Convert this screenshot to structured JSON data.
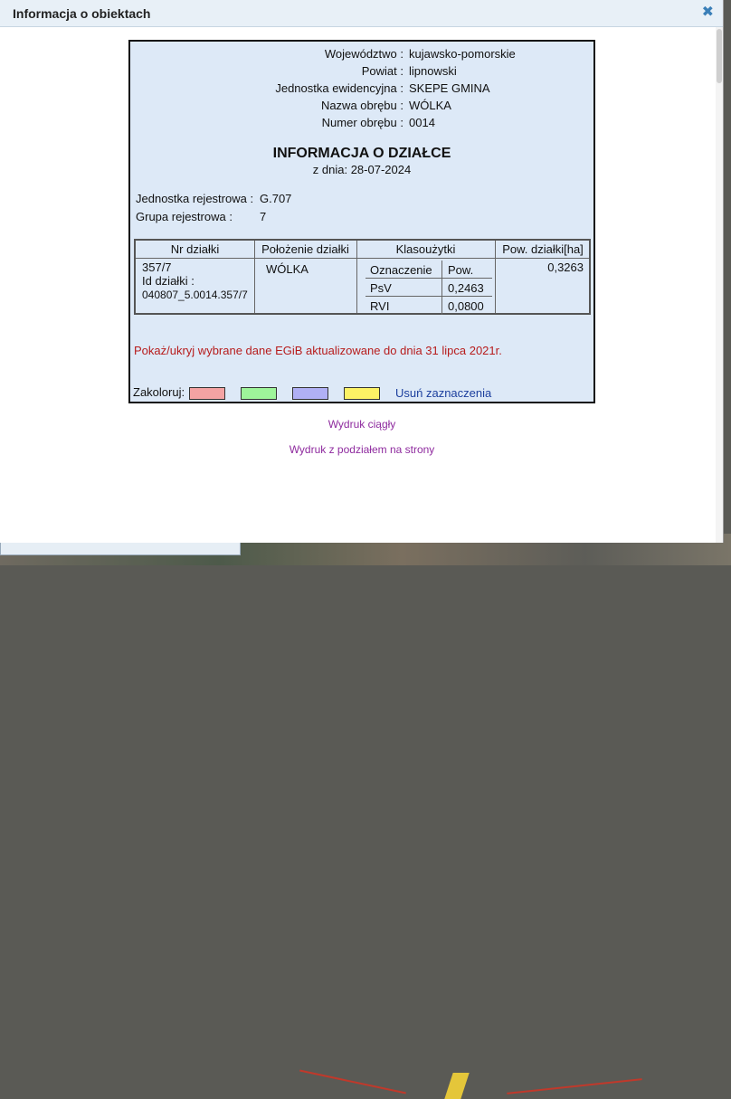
{
  "dialog": {
    "title": "Informacja o obiektach",
    "close_glyph": "✖"
  },
  "location": [
    {
      "label": "Województwo :",
      "value": "kujawsko-pomorskie"
    },
    {
      "label": "Powiat :",
      "value": "lipnowski"
    },
    {
      "label": "Jednostka ewidencyjna :",
      "value": "SKEPE GMINA"
    },
    {
      "label": "Nazwa obrębu :",
      "value": "WÓLKA"
    },
    {
      "label": "Numer obrębu :",
      "value": "0014"
    }
  ],
  "heading": "INFORMACJA O DZIAŁCE",
  "date": "z dnia: 28-07-2024",
  "registry": {
    "unit_label": "Jednostka rejestrowa :",
    "unit_value": "G.707",
    "group_label": "Grupa rejestrowa :",
    "group_value": "7"
  },
  "table": {
    "headers": [
      "Nr działki",
      "Położenie działki",
      "Klasoużytki",
      "Pow. działki[ha]"
    ],
    "parcel_number": "357/7",
    "parcel_id_label": "Id działki :",
    "parcel_id": "040807_5.0014.357/7",
    "location": "WÓLKA",
    "area": "0,3263",
    "klas_headers": [
      "Oznaczenie",
      "Pow."
    ],
    "klas_rows": [
      {
        "code": "PsV",
        "area": "0,2463"
      },
      {
        "code": "RVI",
        "area": "0,0800"
      }
    ]
  },
  "egib_link": "Pokaż/ukryj wybrane dane EGiB aktualizowane do dnia 31 lipca 2021r.",
  "colorize": {
    "label": "Zakoloruj:",
    "swatches": [
      "#f4a3a3",
      "#9ef59a",
      "#b0b0f5",
      "#fcf265"
    ],
    "clear": "Usuń zaznaczenia"
  },
  "print": {
    "continuous": "Wydruk ciągły",
    "paged": "Wydruk z podziałem na strony"
  },
  "watermark": "expander"
}
